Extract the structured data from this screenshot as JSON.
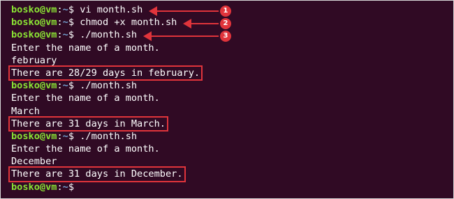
{
  "prompt": {
    "user": "bosko@vm",
    "sep": ":",
    "path": "~",
    "symbol": "$"
  },
  "lines": [
    {
      "type": "prompt",
      "cmd": " vi month.sh"
    },
    {
      "type": "prompt",
      "cmd": " chmod +x month.sh"
    },
    {
      "type": "prompt",
      "cmd": " ./month.sh"
    },
    {
      "type": "output",
      "text": "Enter the name of a month."
    },
    {
      "type": "output",
      "text": "february"
    },
    {
      "type": "output",
      "text": "There are 28/29 days in february.",
      "highlighted": true
    },
    {
      "type": "prompt",
      "cmd": " ./month.sh"
    },
    {
      "type": "output",
      "text": "Enter the name of a month."
    },
    {
      "type": "output",
      "text": "March"
    },
    {
      "type": "output",
      "text": "There are 31 days in March.",
      "highlighted": true
    },
    {
      "type": "prompt",
      "cmd": " ./month.sh"
    },
    {
      "type": "output",
      "text": "Enter the name of a month."
    },
    {
      "type": "output",
      "text": "December"
    },
    {
      "type": "output",
      "text": "There are 31 days in December.",
      "highlighted": true
    },
    {
      "type": "prompt",
      "cmd": ""
    }
  ],
  "annotations": [
    {
      "line": 0,
      "number": "1"
    },
    {
      "line": 1,
      "number": "2"
    },
    {
      "line": 2,
      "number": "3"
    }
  ],
  "colors": {
    "background": "#300a24",
    "user": "#8ae234",
    "path": "#729fcf",
    "text": "#ffffff",
    "annotation": "#e0343b"
  }
}
